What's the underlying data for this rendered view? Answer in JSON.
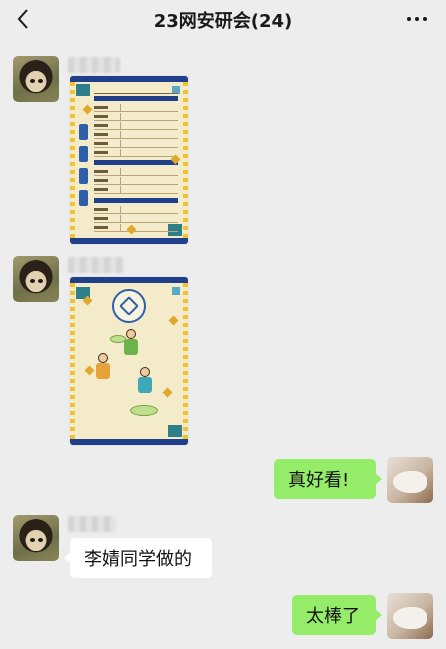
{
  "header": {
    "title": "23网安研会(24)",
    "back_icon": "chevron-left-icon",
    "more_icon": "more-horizontal-icon"
  },
  "messages": [
    {
      "side": "left",
      "type": "image",
      "description_kind": "poster-form"
    },
    {
      "side": "left",
      "type": "image",
      "description_kind": "poster-illustration"
    },
    {
      "side": "right",
      "type": "text",
      "text": "真好看!"
    },
    {
      "side": "left",
      "type": "text",
      "text": "李婧同学做的"
    },
    {
      "side": "right",
      "type": "text",
      "text": "太棒了"
    }
  ],
  "colors": {
    "background": "#ededed",
    "bubble_self": "#95ec69",
    "bubble_other": "#ffffff",
    "poster_navy": "#1f3f8a",
    "poster_cream": "#f3ebc9"
  }
}
